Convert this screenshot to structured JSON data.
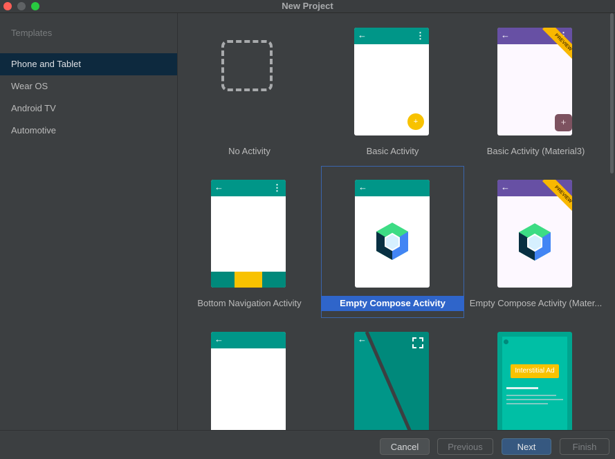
{
  "window": {
    "title": "New Project"
  },
  "sidebar": {
    "header": "Templates",
    "items": [
      {
        "label": "Phone and Tablet",
        "selected": true
      },
      {
        "label": "Wear OS",
        "selected": false
      },
      {
        "label": "Android TV",
        "selected": false
      },
      {
        "label": "Automotive",
        "selected": false
      }
    ]
  },
  "templates": [
    {
      "label": "No Activity"
    },
    {
      "label": "Basic Activity"
    },
    {
      "label": "Basic Activity (Material3)",
      "badge": "PREVIEW"
    },
    {
      "label": "Bottom Navigation Activity"
    },
    {
      "label": "Empty Compose Activity",
      "selected": true
    },
    {
      "label": "Empty Compose Activity (Mater...",
      "badge": "PREVIEW"
    },
    {
      "label": ""
    },
    {
      "label": ""
    },
    {
      "label": "",
      "ad_label": "Interstitial Ad"
    }
  ],
  "footer": {
    "cancel": "Cancel",
    "previous": "Previous",
    "next": "Next",
    "finish": "Finish"
  },
  "colors": {
    "teal": "#009688",
    "purple": "#6750a4",
    "accent": "#f8c200",
    "selection": "#2f65ca"
  }
}
